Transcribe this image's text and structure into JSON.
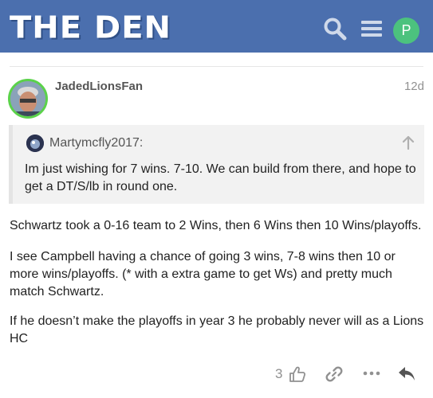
{
  "site": {
    "logo_text": "THE DEN",
    "user_initial": "P",
    "accent": "#4b6fae"
  },
  "header": {
    "icons": [
      "search-icon",
      "hamburger-menu-icon",
      "user-avatar"
    ]
  },
  "post": {
    "username": "JadedLionsFan",
    "date": "12d",
    "quote": {
      "username": "Martymcfly2017:",
      "text": "Im just wishing for 7 wins. 7-10. We can build from there, and hope to get a DT/S/lb in round one."
    },
    "paragraphs": [
      "Schwartz took a 0-16 team to 2 Wins, then 6 Wins then 10 Wins/playoffs.",
      "I see Campbell having a chance of going 3 wins, 7-8 wins then 10 or more wins/playoffs. (* with a extra game to get Ws) and pretty much match Schwartz.",
      "If he doesn’t make the playoffs in year 3 he probably never will as a Lions HC"
    ],
    "like_count": "3"
  }
}
